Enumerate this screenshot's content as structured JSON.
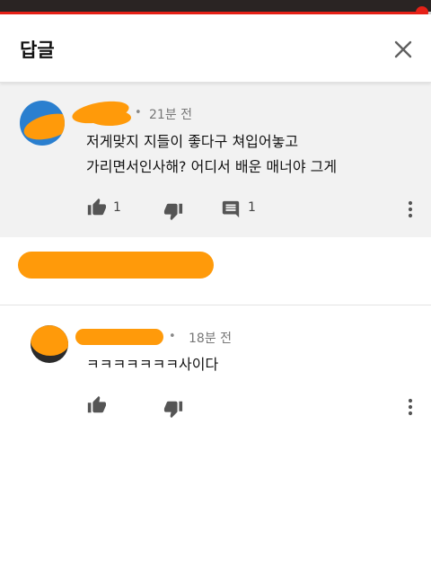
{
  "player": {
    "progress_percent": 98
  },
  "header": {
    "title": "답글",
    "close_icon": "close-icon"
  },
  "parent_comment": {
    "dot": "•",
    "time": "21분 전",
    "text_line1": "저게맞지 지들이 좋다구 쳐입어놓고",
    "text_line2": "가리면서인사해? 어디서 배운 매너야 그게",
    "likes": "1",
    "replies": "1",
    "icons": [
      "thumbs-up-icon",
      "thumbs-down-icon",
      "comment-icon",
      "more-vert-icon"
    ]
  },
  "reply_comment": {
    "dot": "•",
    "time": "18분 전",
    "text": "ㅋㅋㅋㅋㅋㅋㅋ사이다",
    "icons": [
      "thumbs-up-icon",
      "thumbs-down-icon",
      "more-vert-icon"
    ]
  },
  "colors": {
    "accent": "#e62117",
    "redaction": "#ff9a0a",
    "avatar_blue": "#2a7fcf"
  }
}
